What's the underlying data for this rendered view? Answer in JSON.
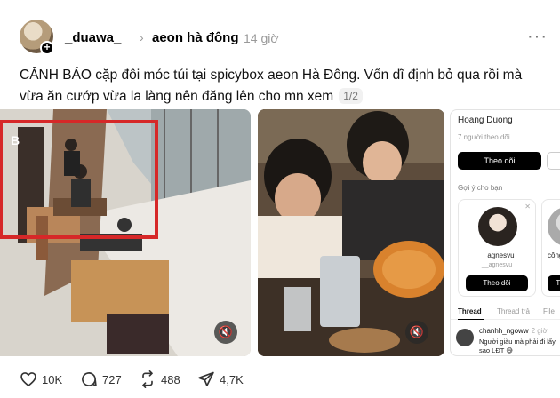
{
  "post": {
    "username": "_duawa_",
    "community": "aeon hà đông",
    "time": "14 giờ",
    "caption": "CẢNH BÁO cặp đôi móc túi tại spicybox aeon Hà Đông. Vốn dĩ định bỏ qua rồi mà vừa ăn cướp vừa la làng nên đăng lên cho mn xem",
    "pager": "1/2"
  },
  "media_preview": {
    "profile_name": "Hoang Duong",
    "followers": "7 người theo dõi",
    "follow_label": "Theo dõi",
    "suggest_title": "Gợi ý cho bạn",
    "suggestions": [
      {
        "name": "__agnesvu",
        "handle": "__agnesvu",
        "button": "Theo dõi"
      },
      {
        "name": "công c",
        "button": "Theo"
      }
    ],
    "tabs": [
      "Thread",
      "Thread trả",
      "File"
    ],
    "reply": {
      "user": "chanhh_ngoww",
      "time": "2 giờ",
      "text": "Người giàu mà phải đi lấy sao LĐT 😅"
    }
  },
  "actions": {
    "likes": "10K",
    "comments": "727",
    "reposts": "488",
    "shares": "4,7K"
  },
  "icons": [
    "plus-icon",
    "chevron-right-icon",
    "more-icon",
    "mute-icon",
    "heart-icon",
    "comment-icon",
    "repost-icon",
    "share-icon"
  ]
}
